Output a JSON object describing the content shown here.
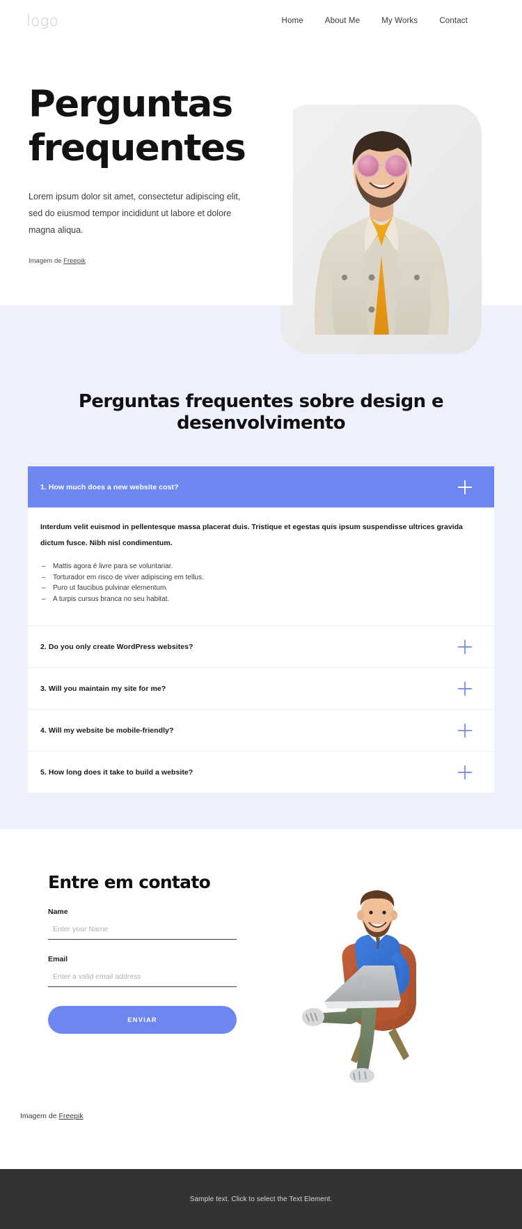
{
  "header": {
    "logo": "logo",
    "nav": [
      {
        "label": "Home"
      },
      {
        "label": "About Me"
      },
      {
        "label": "My Works"
      },
      {
        "label": "Contact"
      }
    ]
  },
  "hero": {
    "title_line1": "Perguntas",
    "title_line2": "frequentes",
    "subtitle": "Lorem ipsum dolor sit amet, consectetur adipiscing elit, sed do eiusmod tempor incididunt ut labore et dolore magna aliqua.",
    "credit_prefix": "Imagem de ",
    "credit_link": "Freepik",
    "photo_alt": "smiling-man-in-beige-denim-jacket-with-pink-sunglasses"
  },
  "faq": {
    "heading": "Perguntas frequentes sobre design e desenvolvimento",
    "items": [
      {
        "question": "1. How much does a new website cost?",
        "open": true,
        "answer_lead": "Interdum velit euismod in pellentesque massa placerat duis. Tristique et egestas quis ipsum suspendisse ultrices gravida dictum fusce. Nibh nisl condimentum.",
        "answer_bullets": [
          "Mattis agora é livre para se voluntariar.",
          "Torturador em risco de viver adipiscing em tellus.",
          "Puro ut faucibus pulvinar elementum.",
          "A turpis cursus branca no seu habitat."
        ]
      },
      {
        "question": "2. Do you only create WordPress websites?",
        "open": false
      },
      {
        "question": "3. Will you maintain my site for me?",
        "open": false
      },
      {
        "question": "4. Will my website be mobile-friendly?",
        "open": false
      },
      {
        "question": "5. How long does it take to build a website?",
        "open": false
      }
    ]
  },
  "contact": {
    "title": "Entre em contato",
    "name_label": "Name",
    "name_placeholder": "Enter your Name",
    "name_value": "",
    "email_label": "Email",
    "email_placeholder": "Enter a valid email address",
    "email_value": "",
    "submit_label": "ENVIAR",
    "credit_prefix": "Imagem de ",
    "credit_link": "Freepik",
    "illustration_alt": "3d-character-man-sitting-in-armchair-with-laptop"
  },
  "footer": {
    "text": "Sample text. Click to select the Text Element."
  },
  "colors": {
    "accent": "#6E86F0",
    "lavender_bg": "#EEF0FC",
    "footer_bg": "#333333",
    "white": "#FFFFFF",
    "text_dark": "#16181D",
    "logo_gray": "#C9C9C9"
  }
}
